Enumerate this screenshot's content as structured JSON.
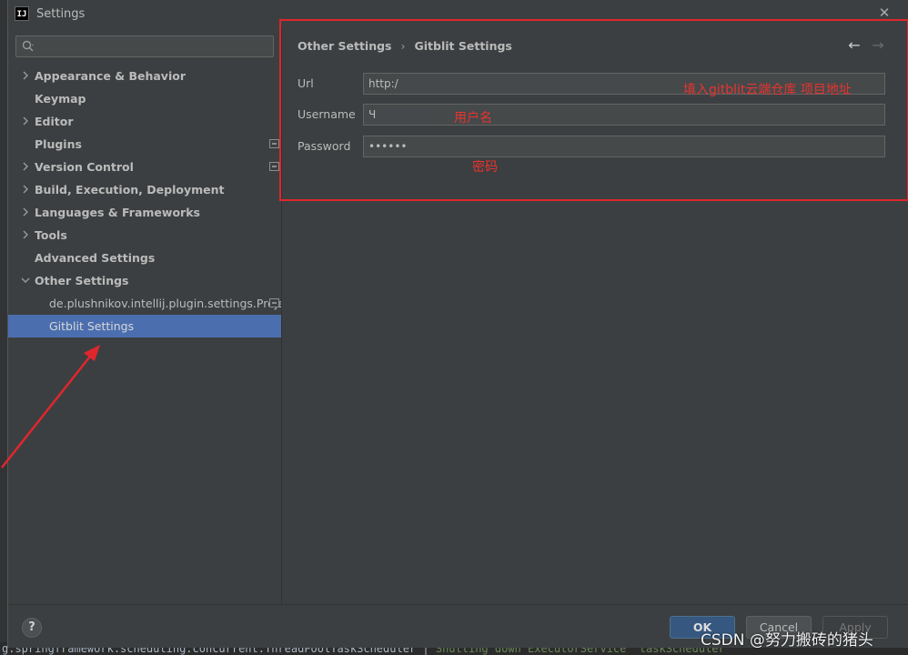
{
  "window": {
    "title": "Settings",
    "app_icon_text": "IJ"
  },
  "search": {
    "placeholder": ""
  },
  "tree": [
    {
      "label": "Appearance & Behavior",
      "expandable": true
    },
    {
      "label": "Keymap",
      "expandable": false
    },
    {
      "label": "Editor",
      "expandable": true
    },
    {
      "label": "Plugins",
      "expandable": false,
      "badge": true
    },
    {
      "label": "Version Control",
      "expandable": true,
      "badge": true
    },
    {
      "label": "Build, Execution, Deployment",
      "expandable": true
    },
    {
      "label": "Languages & Frameworks",
      "expandable": true
    },
    {
      "label": "Tools",
      "expandable": true
    },
    {
      "label": "Advanced Settings",
      "expandable": false
    },
    {
      "label": "Other Settings",
      "expandable": true,
      "expanded": true
    },
    {
      "label": "de.plushnikov.intellij.plugin.settings.Proje",
      "child": true,
      "badge": true
    },
    {
      "label": "Gitblit Settings",
      "child": true,
      "selected": true
    }
  ],
  "breadcrumb": {
    "parent": "Other Settings",
    "separator": "›",
    "current": "Gitblit Settings"
  },
  "nav": {
    "back": "←",
    "forward": "→"
  },
  "form": {
    "url_label": "Url",
    "url_value": "http:/",
    "username_label": "Username",
    "username_value": "Ч",
    "password_label": "Password",
    "password_value": "••••••"
  },
  "annotations": {
    "url_note": "填入gitblit云端仓库 项目地址",
    "username_note": "用户名",
    "password_note": "密码"
  },
  "footer": {
    "help": "?",
    "ok": "OK",
    "cancel": "Cancel",
    "apply": "Apply"
  },
  "watermark": "CSDN @努力搬砖的猪头",
  "background_code": {
    "prefix": "g.springframework.scheduling.concurrent.ThreadPoolTaskScheduler",
    "sep": " | ",
    "message": "Shutting down ExecutorService 'taskScheduler'"
  },
  "colors": {
    "dialog_bg": "#3c3f41",
    "selection": "#4b6eaf",
    "annotation_red": "#e0262d",
    "ok_button": "#365880"
  }
}
